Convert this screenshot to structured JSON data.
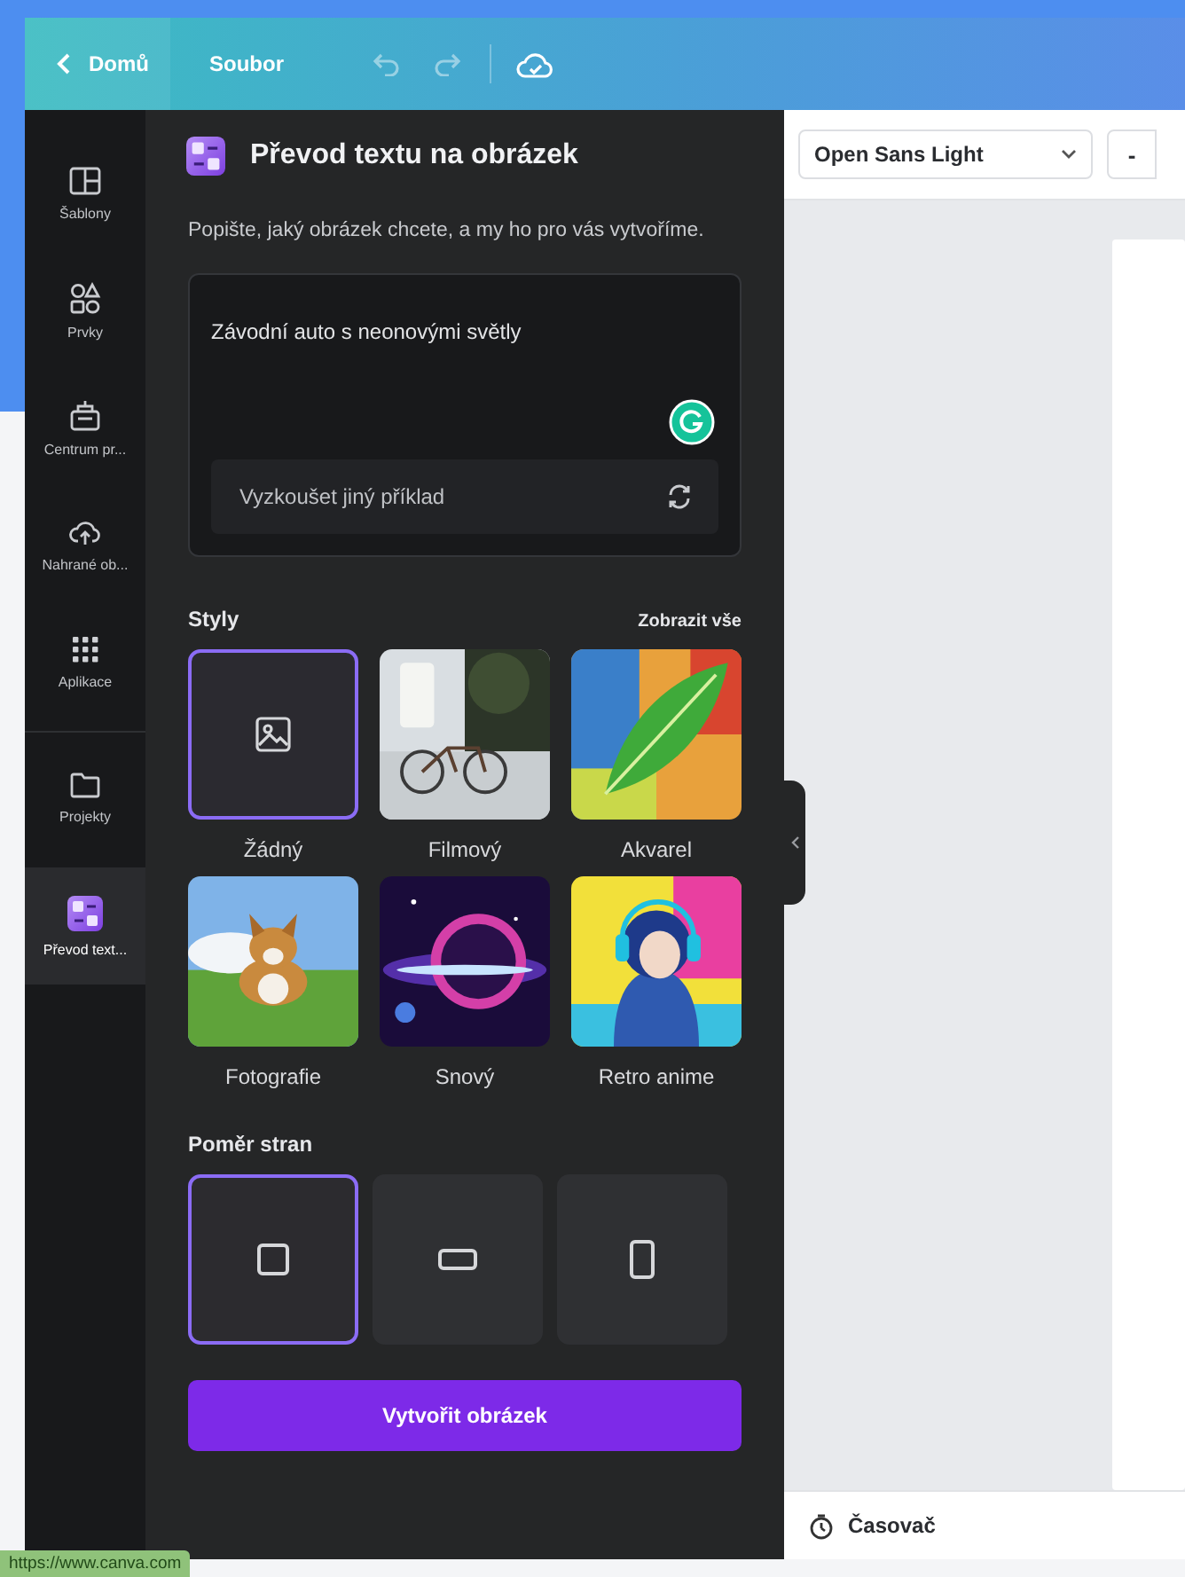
{
  "topbar": {
    "home": "Domů",
    "file": "Soubor"
  },
  "rail": [
    {
      "label": "Šablony",
      "kind": "templates",
      "selected": false
    },
    {
      "label": "Prvky",
      "kind": "elements",
      "selected": false
    },
    {
      "label": "Centrum pr...",
      "kind": "brand",
      "selected": false
    },
    {
      "label": "Nahrané ob...",
      "kind": "upload",
      "selected": false
    },
    {
      "label": "Aplikace",
      "kind": "apps",
      "selected": false
    },
    {
      "label": "Projekty",
      "kind": "folder",
      "selected": false
    },
    {
      "label": "Převod text...",
      "kind": "app",
      "selected": true
    }
  ],
  "panel": {
    "title": "Převod textu na obrázek",
    "description": "Popište, jaký obrázek chcete, a my ho pro vás vytvoříme.",
    "prompt": "Závodní auto s neonovými světly",
    "example_button": "Vyzkoušet jiný příklad",
    "styles_heading": "Styly",
    "see_all": "Zobrazit vše",
    "styles": [
      {
        "name": "Žádný",
        "kind": "none",
        "selected": true
      },
      {
        "name": "Filmový",
        "kind": "picture",
        "selected": false
      },
      {
        "name": "Akvarel",
        "kind": "picture",
        "selected": false
      },
      {
        "name": "Fotografie",
        "kind": "picture",
        "selected": false
      },
      {
        "name": "Snový",
        "kind": "picture",
        "selected": false
      },
      {
        "name": "Retro anime",
        "kind": "picture",
        "selected": false
      }
    ],
    "ratio_heading": "Poměr stran",
    "ratios": [
      {
        "kind": "square",
        "selected": true
      },
      {
        "kind": "wide",
        "selected": false
      },
      {
        "kind": "tall",
        "selected": false
      }
    ],
    "create_button": "Vytvořit obrázek"
  },
  "editor": {
    "font": "Open Sans Light",
    "minus": "-",
    "timer": "Časovač"
  },
  "status_url": "https://www.canva.com"
}
